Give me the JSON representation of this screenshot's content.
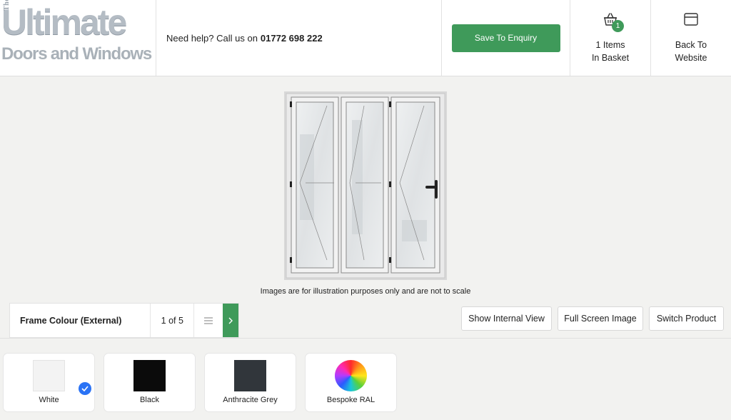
{
  "logo": {
    "the": "The",
    "ultimate": "Ultimate",
    "subtitle": "Doors and Windows"
  },
  "help": {
    "prefix": "Need help? Call us on",
    "phone": "01772 698 222"
  },
  "save_button": "Save To Enquiry",
  "basket": {
    "count": "1",
    "line1": "1 Items",
    "line2": "In Basket",
    "icon": "basket-icon"
  },
  "back": {
    "line1": "Back To",
    "line2": "Website",
    "icon": "browser-window-icon"
  },
  "caption": "Images are for illustration purposes only and are not to scale",
  "option": {
    "title": "Frame Colour (External)",
    "count": "1 of 5",
    "list_icon": "list-icon",
    "next_icon": "chevron-right-icon"
  },
  "toolbar": {
    "internal": "Show Internal View",
    "fullscreen": "Full Screen Image",
    "switch": "Switch Product"
  },
  "swatches": [
    {
      "label": "White",
      "color": "#f3f3f3",
      "selected": true
    },
    {
      "label": "Black",
      "color": "#0b0b0b",
      "selected": false
    },
    {
      "label": "Anthracite Grey",
      "color": "#31363b",
      "selected": false
    },
    {
      "label": "Bespoke RAL",
      "color": "rainbow",
      "selected": false
    }
  ],
  "colors": {
    "accent": "#3f9a5a",
    "check": "#2a73f5"
  }
}
